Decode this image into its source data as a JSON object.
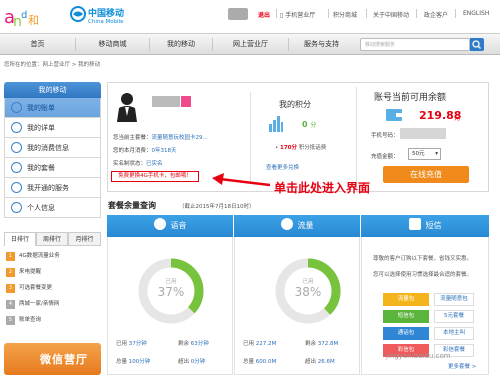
{
  "header": {
    "logo_and_text": "and和",
    "brand_cn": "中国移动",
    "brand_en": "China Mobile",
    "top_links": [
      "退出",
      "手机营业厅",
      "积分商城",
      "关于中国移动",
      "政企客户",
      "ENGLISH"
    ]
  },
  "nav": {
    "items": [
      "首页",
      "移动商城",
      "我的移动",
      "网上营业厅",
      "服务与支持"
    ],
    "search_placeholder": "移动搜索服务"
  },
  "breadcrumb": "您所在的位置：网上营业厅 > 我的移动",
  "sidebar": {
    "title": "我的移动",
    "items": [
      {
        "label": "我的账单",
        "icon": "bill-icon"
      },
      {
        "label": "我的详单",
        "icon": "detail-icon"
      },
      {
        "label": "我的消费信息",
        "icon": "consume-icon"
      },
      {
        "label": "我的套餐",
        "icon": "package-icon"
      },
      {
        "label": "我开通的服务",
        "icon": "service-icon"
      },
      {
        "label": "个人信息",
        "icon": "user-icon"
      }
    ],
    "rank_tabs": [
      "日排行",
      "周排行",
      "月排行"
    ],
    "rank_items": [
      "4G数据流量业务",
      "来电提醒",
      "可选套餐变更",
      "两城一家/亲情网",
      "账单查询"
    ],
    "promo_text": "微信营厅"
  },
  "account": {
    "plan_label": "您当前主套餐：",
    "plan_value": "流量随意玩校园卡29...",
    "balance_label": "您的本月消费：",
    "balance_value": "0年318天",
    "realname_label": "实名制状态：",
    "realname_value": "已实名",
    "upgrade_text": "免费更换4G手机卡，包邮哦！",
    "points_title": "我的积分",
    "points_value": "0",
    "points_unit": "分",
    "points_sub_prefix": "•",
    "points_sub_value": "170分",
    "points_sub_suffix": "积分抵话费",
    "points_link": "查看更多兑换",
    "balance_title": "账号当前可用余额",
    "balance_amount": "219.88",
    "balance_unit": "元",
    "phone_label": "手机号码：",
    "amount_label": "充值金额：",
    "amount_value": "50元",
    "pay_button": "在线充值"
  },
  "annotation": "单击此处进入界面",
  "package": {
    "title": "套餐余量查询",
    "note": "（截止2015年7月18日10时）",
    "columns": [
      {
        "name": "语音",
        "used_label": "已用",
        "percent": 37,
        "percent_text": "37%",
        "rows": [
          [
            "已用",
            "37分钟"
          ],
          [
            "剩余",
            "63分钟"
          ],
          [
            "总量",
            "100分钟"
          ],
          [
            "超出",
            "0分钟"
          ]
        ]
      },
      {
        "name": "流量",
        "used_label": "已用",
        "percent": 38,
        "percent_text": "38%",
        "rows": [
          [
            "已用",
            "227.2M"
          ],
          [
            "剩余",
            "372.8M"
          ],
          [
            "总量",
            "600.0M"
          ],
          [
            "超出",
            "26.6M"
          ]
        ]
      },
      {
        "name": "短信",
        "text_lines": [
          "尊敬的客户订购以下套餐，省钱又实惠。",
          "您可以选择使用习惯选择最合适的套餐。"
        ],
        "buttons": [
          {
            "label": "流量包",
            "link": "流量随意包",
            "color": "#f3b51b"
          },
          {
            "label": "短信包",
            "link": "5元套餐",
            "color": "#5bb43c"
          },
          {
            "label": "通话包",
            "link": "本地主叫",
            "color": "#2e86d4"
          },
          {
            "label": "彩信包",
            "link": "彩信套餐",
            "color": "#ef5a5a"
          }
        ],
        "more": "更多套餐 >"
      }
    ]
  },
  "watermark": "jingyan.baidu.com"
}
